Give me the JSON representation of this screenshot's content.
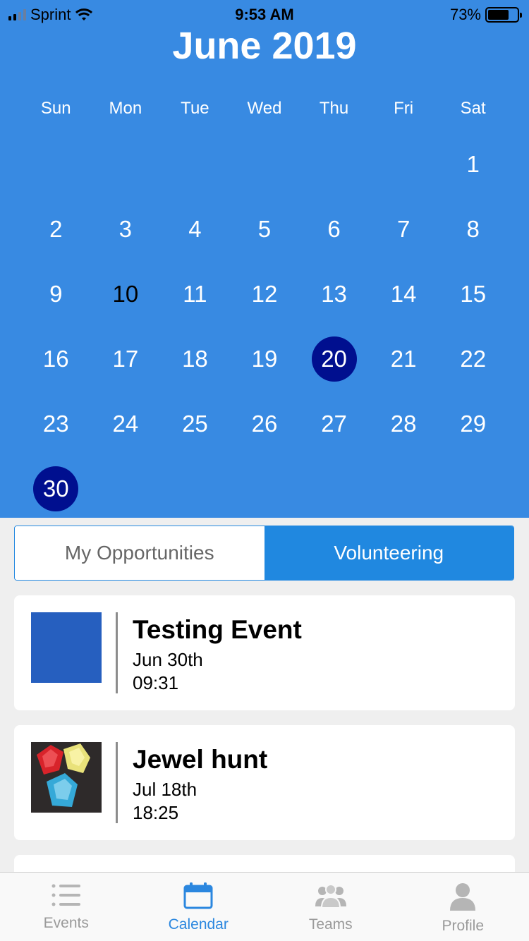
{
  "status_bar": {
    "carrier": "Sprint",
    "time": "9:53 AM",
    "battery": "73%"
  },
  "calendar": {
    "title": "June 2019",
    "weekdays": [
      "Sun",
      "Mon",
      "Tue",
      "Wed",
      "Thu",
      "Fri",
      "Sat"
    ],
    "days": [
      "1",
      "2",
      "3",
      "4",
      "5",
      "6",
      "7",
      "8",
      "9",
      "10",
      "11",
      "12",
      "13",
      "14",
      "15",
      "16",
      "17",
      "18",
      "19",
      "20",
      "21",
      "22",
      "23",
      "24",
      "25",
      "26",
      "27",
      "28",
      "29",
      "30"
    ],
    "today": "10",
    "selected_days": [
      "20",
      "30"
    ]
  },
  "segments": {
    "my_opportunities": "My Opportunities",
    "volunteering": "Volunteering"
  },
  "events": [
    {
      "title": "Testing Event",
      "date": "Jun 30th",
      "time": "09:31"
    },
    {
      "title": "Jewel hunt",
      "date": "Jul 18th",
      "time": "18:25"
    }
  ],
  "tabbar": {
    "events": "Events",
    "calendar": "Calendar",
    "teams": "Teams",
    "profile": "Profile"
  },
  "colors": {
    "header_blue": "#388ae2",
    "selected_day": "#000f8f",
    "active_segment": "#2088e0",
    "active_tab": "#2b87df",
    "event_thumb_blue": "#265fbf"
  }
}
